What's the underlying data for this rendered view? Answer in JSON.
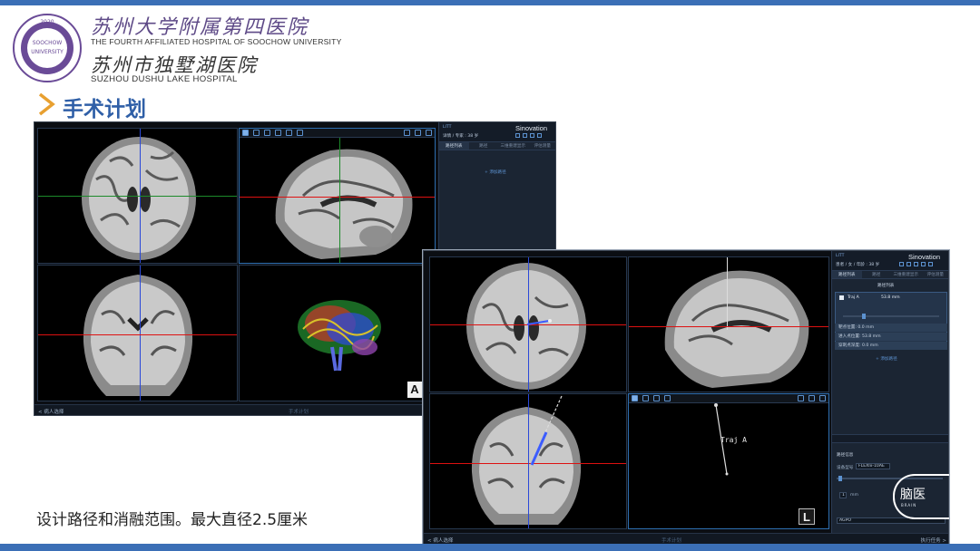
{
  "header": {
    "seal_text": "蘇大附四院 2020 SOOCHOW UNIVERSITY THE FOURTH AFFILIATED HOSPITAL",
    "hospital_cn": "苏州大学附属第四医院",
    "hospital_en": "THE FOURTH AFFILIATED HOSPITAL OF SOOCHOW UNIVERSITY",
    "lake_cn": "苏州市独墅湖医院",
    "lake_en": "SUZHOU DUSHU LAKE HOSPITAL",
    "section_title": "手术计划"
  },
  "caption": "设计路径和消融范围。最大直径2.5厘米",
  "win1": {
    "panel": {
      "user": "LITT",
      "case": "详情 / 专家 : 38 岁",
      "brand": "Sinovation",
      "tabs": [
        "路径列表",
        "路径",
        "三维重建显示",
        "评估测量"
      ],
      "add_label": "添加路径"
    },
    "corner_letter": "A",
    "bottom": {
      "left": "< 病人选择",
      "mid": "手术计划"
    }
  },
  "win2": {
    "panel": {
      "user": "LITT",
      "case": "患者 / 女 / 年龄 : 38 岁",
      "brand": "Sinovation",
      "tabs": [
        "路径列表",
        "路径",
        "三维重建显示",
        "评估测量"
      ],
      "list_title": "路径列表",
      "trajectory": {
        "name": "Traj A",
        "length": "53.8 mm"
      },
      "info_rows": [
        "靶点位置: 0.0 mm",
        "进入点位置: 53.8 mm",
        "穿刺点深度: 0.0 mm"
      ],
      "add_label": "添加路径",
      "section_label": "路径信息",
      "device_label": "设备型号",
      "device_value": "FLEXIx-10AE",
      "step_label": "步长",
      "step_value": "1",
      "step_unit": "mm",
      "dropdown_value": "AGPO"
    },
    "traj_label": "Traj A",
    "corner_letter": "L",
    "bottom": {
      "left": "< 病人选择",
      "mid": "手术计划",
      "right": "执行任务 >"
    },
    "watermark": {
      "text": "脑医",
      "sub": "BRAIN"
    }
  }
}
